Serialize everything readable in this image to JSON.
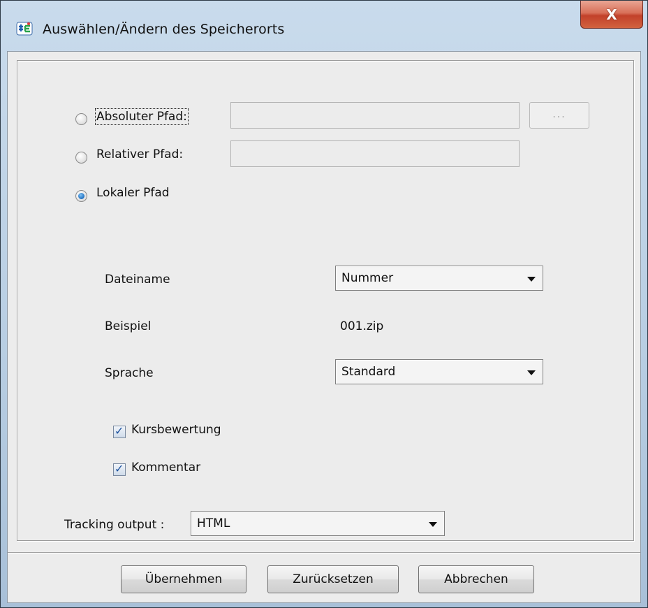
{
  "window": {
    "title": "Auswählen/Ändern des Speicherorts",
    "close_label": "X",
    "app_icon": "app-logo-icon"
  },
  "path_options": {
    "absolute": {
      "label": "Absoluter Pfad:",
      "checked": false,
      "value": "",
      "browse_label": "..."
    },
    "relative": {
      "label": "Relativer Pfad:",
      "checked": false,
      "value": ""
    },
    "local": {
      "label": "Lokaler Pfad",
      "checked": true
    }
  },
  "settings": {
    "filename": {
      "label": "Dateiname",
      "selected": "Nummer"
    },
    "example": {
      "label": "Beispiel",
      "value": "001.zip"
    },
    "language": {
      "label": "Sprache",
      "selected": "Standard"
    },
    "course_rating": {
      "label": "Kursbewertung",
      "checked": true
    },
    "comment": {
      "label": "Kommentar",
      "checked": true
    }
  },
  "tracking": {
    "label": "Tracking output :",
    "selected": "HTML"
  },
  "buttons": {
    "apply": "Übernehmen",
    "reset": "Zurücksetzen",
    "cancel": "Abbrechen"
  },
  "colors": {
    "title_gradient": "#b7cde2",
    "client_bg": "#ececec",
    "close_red": "#c2412a",
    "radio_selected": "#1f6fbf"
  }
}
